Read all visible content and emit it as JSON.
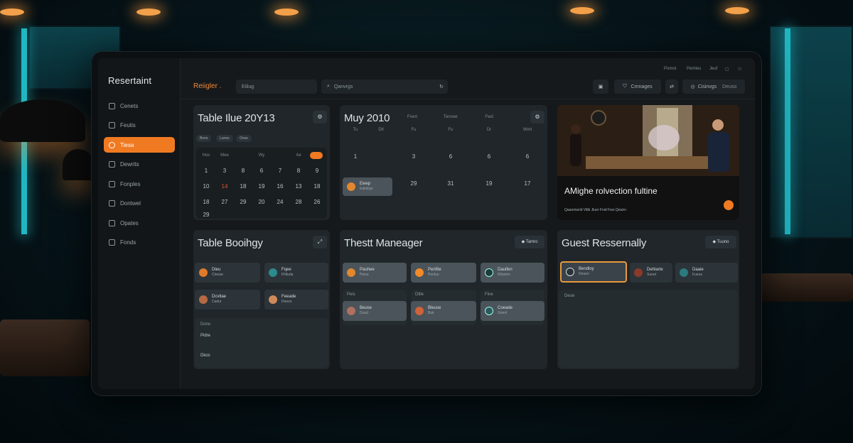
{
  "sidebar": {
    "brand": "Resertaint",
    "items": [
      {
        "icon": "grid-icon",
        "label": "Cenets"
      },
      {
        "icon": "calendar-icon",
        "label": "Feutis"
      },
      {
        "icon": "clock-icon",
        "label": "Tiesa"
      },
      {
        "icon": "list-icon",
        "label": "Dewrits"
      },
      {
        "icon": "tag-icon",
        "label": "Fonples"
      },
      {
        "icon": "chart-icon",
        "label": "Dontwel"
      },
      {
        "icon": "settings-icon",
        "label": "Opates"
      },
      {
        "icon": "file-icon",
        "label": "Fonds"
      }
    ],
    "active_index": 2
  },
  "topbar": {
    "title": "Reiigler .",
    "field1": "Eiliug",
    "search_placeholder": "Qanvrgs",
    "mini_links": [
      "Pomot",
      "Pemtes",
      "Jeuf"
    ],
    "btn_manage": "Cmnages",
    "btn_account": "Cisinvgs",
    "btn_account_sub": "Deuso"
  },
  "panels": {
    "table_cal": {
      "title": "Table Ilue 20Y13",
      "chips": [
        "Bons",
        "Lunes",
        "Onse"
      ],
      "week_labels": [
        "Hos",
        "Mee",
        "Wy",
        "Ae"
      ],
      "rows": [
        [
          "1",
          "3",
          "8",
          "6",
          "7",
          "8",
          "9"
        ],
        [
          "10",
          "14",
          "18",
          "19",
          "16",
          "13",
          "18"
        ],
        [
          "18",
          "27",
          "29",
          "20",
          "24",
          "28",
          "26"
        ],
        [
          "29"
        ]
      ]
    },
    "month_cal": {
      "title": "Muy 2010",
      "heads_top": [
        "Frent",
        "Tenreer",
        "Fwd"
      ],
      "heads": [
        "Tu",
        "Dtl",
        "Fu",
        "Fu",
        "Dr",
        "Wmt"
      ],
      "row1": [
        "1",
        "3",
        "6",
        "6",
        "6"
      ],
      "row2": [
        "29",
        "31",
        "19",
        "17"
      ],
      "event": {
        "t1": "Ewep",
        "t2": "Eakdrge"
      }
    },
    "photo": {
      "caption": "AMighe rolvection fultine",
      "tags": "Qaanmwriit    Vitlb   Jluer   Fnid   Fwo   Qeuirn"
    },
    "booking": {
      "title": "Table Booihgy",
      "cards": [
        {
          "t1": "Dleu",
          "t2": "Cleeae"
        },
        {
          "t1": "Fqee",
          "t2": "Fhlluda"
        },
        {
          "t1": "Dcvltae",
          "t2": "Cadui"
        },
        {
          "t1": "Feeade",
          "t2": "Deeos"
        }
      ],
      "sub_lines": [
        "Donu",
        "Pidre",
        "Dkos"
      ]
    },
    "manager": {
      "title": "Thestt Maneager",
      "badge": "Tamro",
      "cards_top": [
        {
          "t1": "Pauhee",
          "t2": "Peisu"
        },
        {
          "t1": "Penfite",
          "t2": "Penluu"
        },
        {
          "t1": "Dauifen",
          "t2": "Wiselen"
        }
      ],
      "labels": [
        "Peis",
        "Dtlle",
        "Fine"
      ],
      "cards_bottom": [
        {
          "t1": "Beuse",
          "t2": "Duud"
        },
        {
          "t1": "Bleuse",
          "t2": "Buk"
        },
        {
          "t1": "Coeade",
          "t2": "Gnenl"
        }
      ]
    },
    "reservations": {
      "title": "Guest Ressernally",
      "badge": "Tuuno",
      "cards": [
        {
          "t1": "Bendloy",
          "t2": "Deuen"
        },
        {
          "t1": "Dehlarte",
          "t2": "Sunet"
        },
        {
          "t1": "Daaie",
          "t2": "Fueus"
        }
      ],
      "sub_label": "Deue"
    }
  },
  "colors": {
    "accent": "#f07a22",
    "panel": "#20262a",
    "background": "#15191c"
  }
}
